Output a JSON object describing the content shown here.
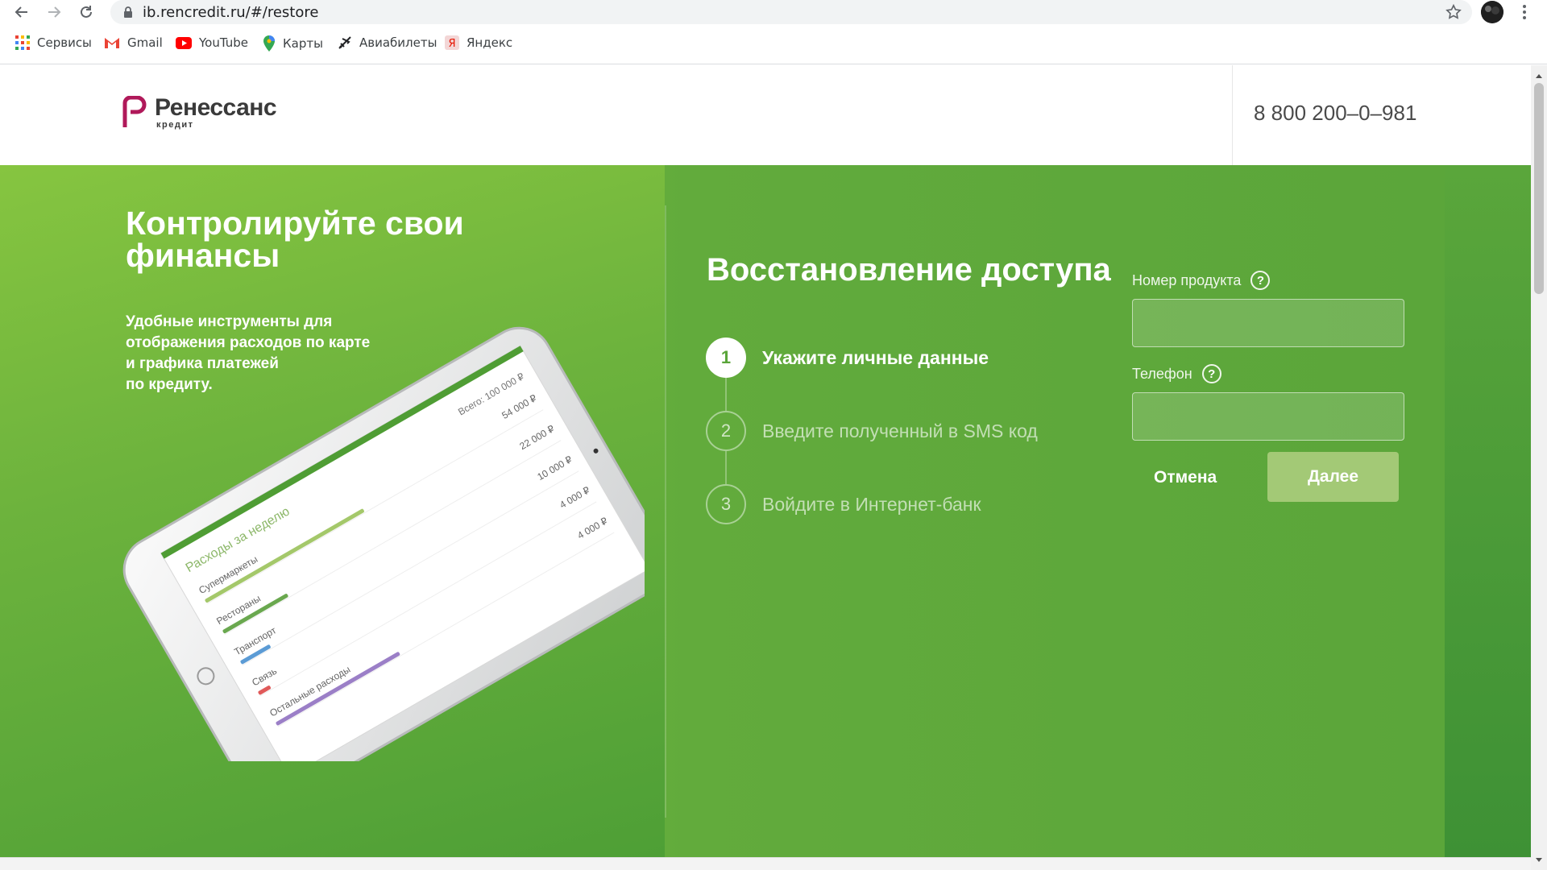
{
  "browser": {
    "url": "ib.rencredit.ru/#/restore",
    "bookmarks": [
      {
        "label": "Сервисы",
        "icon": "apps-grid-icon"
      },
      {
        "label": "Gmail",
        "icon": "gmail-icon"
      },
      {
        "label": "YouTube",
        "icon": "youtube-icon"
      },
      {
        "label": "Карты",
        "icon": "maps-pin-icon"
      },
      {
        "label": "Авиабилеты",
        "icon": "plane-icon"
      },
      {
        "label": "Яндекс",
        "icon": "yandex-icon"
      }
    ]
  },
  "header": {
    "logo_name": "Ренессанс",
    "logo_sub": "кредит",
    "phone": "8 800 200–0–981"
  },
  "hero": {
    "title": "Контролируйте свои финансы",
    "description": "Удобные инструменты для\nотображения расходов по карте\nи графика платежей\nпо кредиту."
  },
  "tablet_screen": {
    "heading": "Расходы за неделю",
    "total_label": "Всего: 100 000 ₽",
    "rows": [
      {
        "label": "Супермаркеты",
        "amount": "54 000 ₽",
        "fraction": 0.54,
        "color": "#a4c86a"
      },
      {
        "label": "Рестораны",
        "amount": "22 000 ₽",
        "fraction": 0.22,
        "color": "#6aa84f"
      },
      {
        "label": "Транспорт",
        "amount": "10 000 ₽",
        "fraction": 0.1,
        "color": "#5b9bd5"
      },
      {
        "label": "Связь",
        "amount": "4 000 ₽",
        "fraction": 0.04,
        "color": "#e05a5a"
      },
      {
        "label": "Остальные расходы",
        "amount": "4 000 ₽",
        "fraction": 0.42,
        "color": "#9b7fc7"
      }
    ]
  },
  "form": {
    "title": "Восстановление доступа",
    "steps": [
      {
        "number": "1",
        "label": "Укажите личные данные",
        "active": true
      },
      {
        "number": "2",
        "label": "Введите полученный в SMS код",
        "active": false
      },
      {
        "number": "3",
        "label": "Войдите в Интернет-банк",
        "active": false
      }
    ],
    "product_label": "Номер продукта",
    "product_value": "",
    "phone_label": "Телефон",
    "phone_value": "",
    "help_glyph": "?",
    "cancel_label": "Отмена",
    "next_label": "Далее"
  },
  "colors": {
    "brand_green": "#5aa53a",
    "logo_magenta": "#b0195a",
    "next_button": "#a3c976"
  }
}
